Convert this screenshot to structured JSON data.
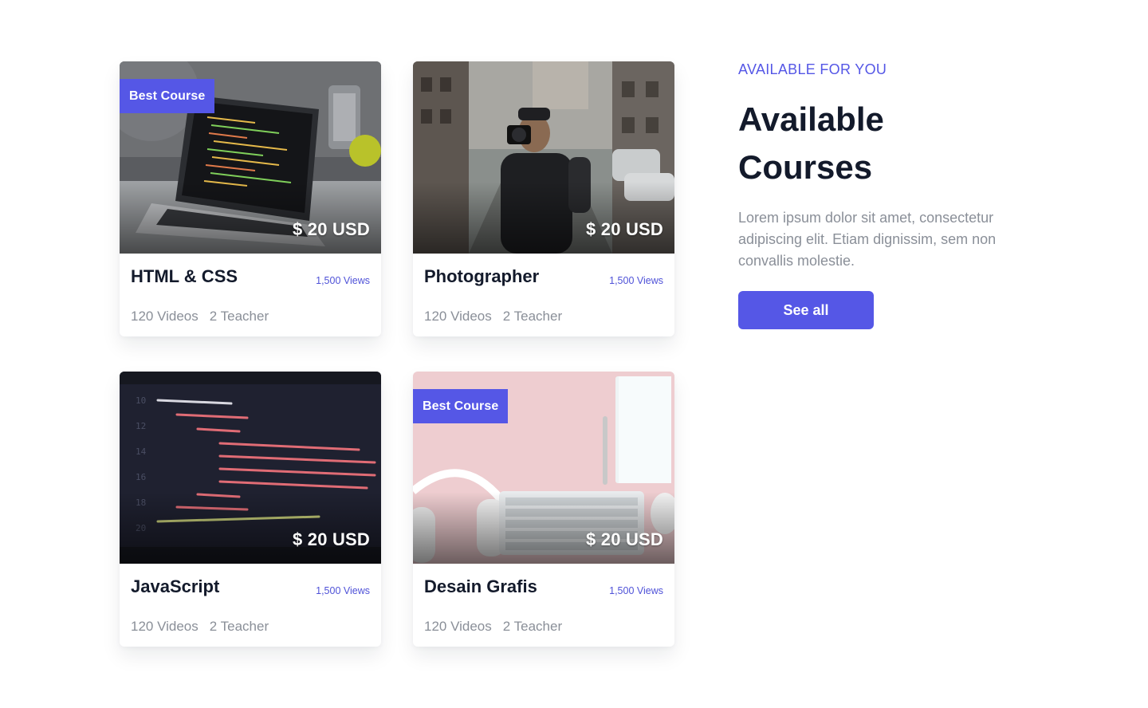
{
  "courses": [
    {
      "title": "HTML & CSS",
      "badge": "Best Course",
      "price": "$ 20 USD",
      "views": "1,500 Views",
      "videos": "120 Videos",
      "teachers": "2 Teacher",
      "image": "laptop-desk-photo"
    },
    {
      "title": "Photographer",
      "badge": "",
      "price": "$ 20 USD",
      "views": "1,500 Views",
      "videos": "120 Videos",
      "teachers": "2 Teacher",
      "image": "street-photographer-photo"
    },
    {
      "title": "JavaScript",
      "badge": "",
      "price": "$ 20 USD",
      "views": "1,500 Views",
      "videos": "120 Videos",
      "teachers": "2 Teacher",
      "image": "code-editor-photo"
    },
    {
      "title": "Desain Grafis",
      "badge": "Best Course",
      "price": "$ 20 USD",
      "views": "1,500 Views",
      "videos": "120 Videos",
      "teachers": "2 Teacher",
      "image": "pink-desk-headphones-photo"
    }
  ],
  "sidebar": {
    "eyebrow": "AVAILABLE FOR YOU",
    "heading": "Available Courses",
    "description": "Lorem ipsum dolor sit amet, consectetur adipiscing elit. Etiam dignissim, sem non convallis molestie.",
    "button_label": "See all"
  },
  "colors": {
    "accent": "#5557E6",
    "heading": "#131A2B",
    "muted": "#8A8F98"
  }
}
